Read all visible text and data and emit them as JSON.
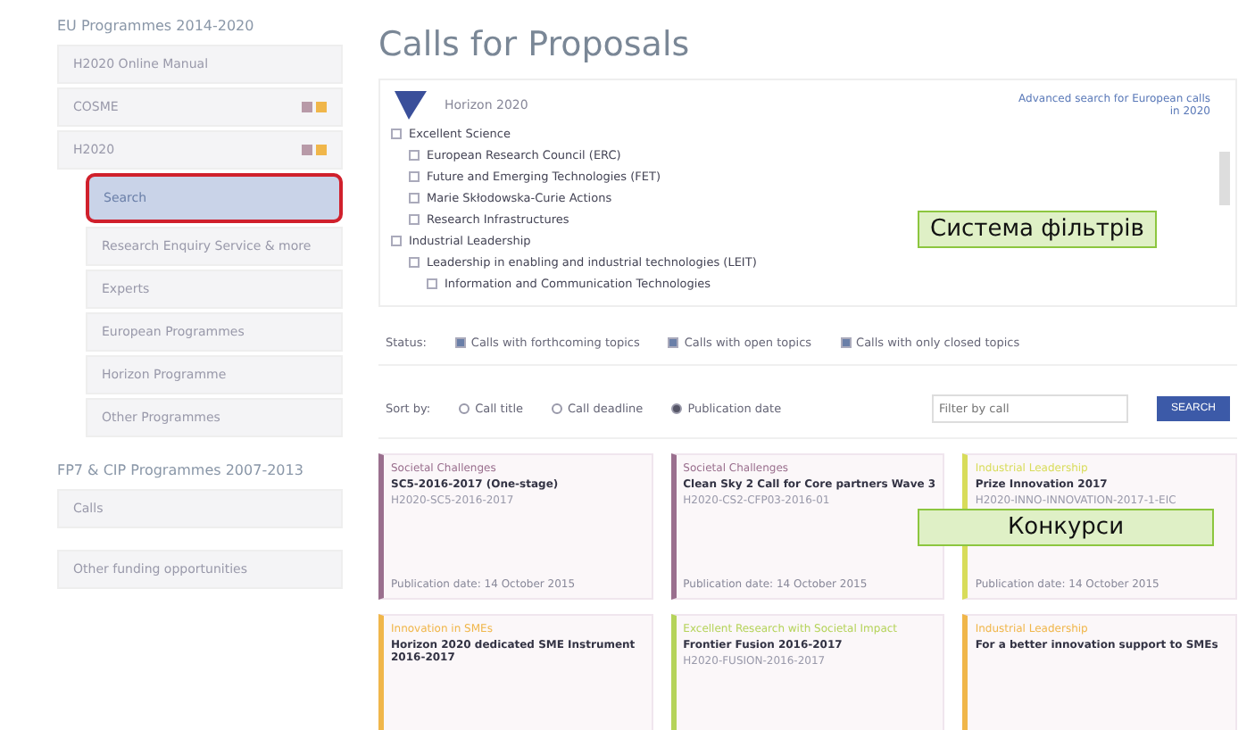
{
  "sidebar": {
    "groups": [
      {
        "title": "EU Programmes 2014-2020",
        "items": [
          {
            "label": "H2020 Online Manual",
            "selected": false
          },
          {
            "label": "COSME",
            "flags": true,
            "selected": false
          },
          {
            "label": "H2020",
            "flags": true,
            "selected": false,
            "children": [
              {
                "label": "Search",
                "selected": true
              },
              {
                "label": "Research Enquiry Service & more",
                "selected": false
              },
              {
                "label": "Experts",
                "selected": false
              },
              {
                "label": "European Programmes",
                "selected": false
              },
              {
                "label": "Horizon Programme",
                "selected": false
              },
              {
                "label": "Other Programmes",
                "selected": false
              }
            ]
          }
        ]
      },
      {
        "title": "FP7 & CIP Programmes 2007-2013",
        "items": [
          {
            "label": "Calls",
            "selected": false
          }
        ]
      },
      {
        "items": [
          {
            "label": "Other funding opportunities",
            "selected": false
          }
        ]
      }
    ]
  },
  "page_title": "Calls for Proposals",
  "filter_panel": {
    "programme": "Horizon 2020",
    "link": "Advanced search for European calls in 2020",
    "tree": [
      {
        "label": "Excellent Science",
        "checked": false,
        "children": [
          {
            "label": "European Research Council (ERC)",
            "checked": false
          },
          {
            "label": "Future and Emerging Technologies (FET)",
            "checked": false
          },
          {
            "label": "Marie Skłodowska-Curie Actions",
            "checked": false
          },
          {
            "label": "Research Infrastructures",
            "checked": false
          }
        ]
      },
      {
        "label": "Industrial Leadership",
        "checked": false,
        "children": [
          {
            "label": "Leadership in enabling and industrial technologies (LEIT)",
            "checked": false,
            "children": [
              {
                "label": "Information and Communication Technologies",
                "checked": false
              }
            ]
          }
        ]
      }
    ]
  },
  "status": {
    "label": "Status:",
    "options": [
      {
        "label": "Calls with forthcoming topics",
        "checked": true
      },
      {
        "label": "Calls with open topics",
        "checked": true
      },
      {
        "label": "Calls with only closed topics",
        "checked": true
      }
    ]
  },
  "sort": {
    "label": "Sort by:",
    "options": [
      {
        "label": "Call title",
        "selected": false
      },
      {
        "label": "Call deadline",
        "selected": false
      },
      {
        "label": "Publication date",
        "selected": true
      }
    ],
    "search": {
      "placeholder": "Filter by call"
    },
    "button": "SEARCH"
  },
  "calls": [
    {
      "pillar": "Societal Challenges",
      "title": "SC5-2016-2017 (One-stage)",
      "id": "H2020-SC5-2016-2017",
      "date": "Publication date: 14 October 2015",
      "color": "#9a6f8e"
    },
    {
      "pillar": "Societal Challenges",
      "title": "Clean Sky 2 Call for Core partners Wave 3",
      "id": "H2020-CS2-CFP03-2016-01",
      "date": "Publication date: 14 October 2015",
      "color": "#9a6f8e"
    },
    {
      "pillar": "Industrial Leadership",
      "title": "Prize Innovation 2017",
      "id": "H2020-INNO-INNOVATION-2017-1-EIC",
      "date": "Publication date: 14 October 2015",
      "color": "#d8dc5a"
    },
    {
      "pillar": "Innovation in SMEs",
      "title": "Horizon 2020 dedicated SME Instrument 2016-2017",
      "color": "#f0b64a"
    },
    {
      "pillar": "Excellent Research with Societal Impact",
      "title": "Frontier Fusion 2016-2017",
      "id": "H2020-FUSION-2016-2017",
      "color": "#b5d35a"
    },
    {
      "pillar": "Industrial Leadership",
      "title": "For a better innovation support to SMEs",
      "color": "#f0b64a"
    }
  ],
  "annotations": [
    {
      "text": "Система фільтрів",
      "kind": "filters"
    },
    {
      "text": "Конкурси",
      "kind": "calls"
    }
  ]
}
